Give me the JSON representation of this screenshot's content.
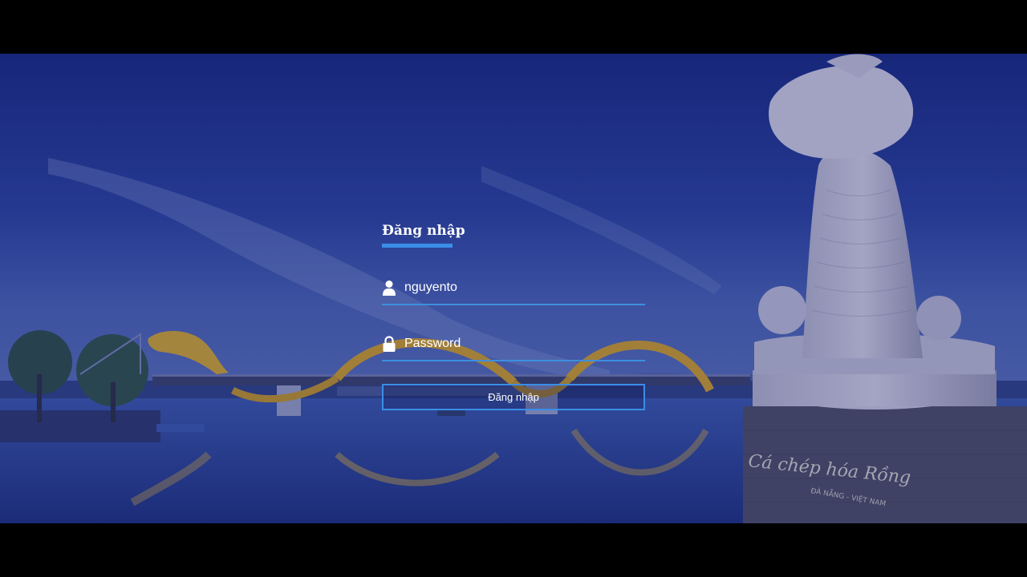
{
  "login": {
    "title": "Đăng nhập",
    "username_value": "nguyento",
    "password_placeholder": "Password",
    "submit_label": "Đăng nhập"
  },
  "background": {
    "monument_inscription": "Cá chép hóa Rồng",
    "monument_subtitle": "ĐÀ NẴNG - VIỆT NAM"
  },
  "colors": {
    "accent": "#3a8ee6",
    "sky_overlay": "#1b2a7a",
    "text": "#ffffff"
  },
  "icons": {
    "username": "user-icon",
    "password": "lock-icon"
  }
}
